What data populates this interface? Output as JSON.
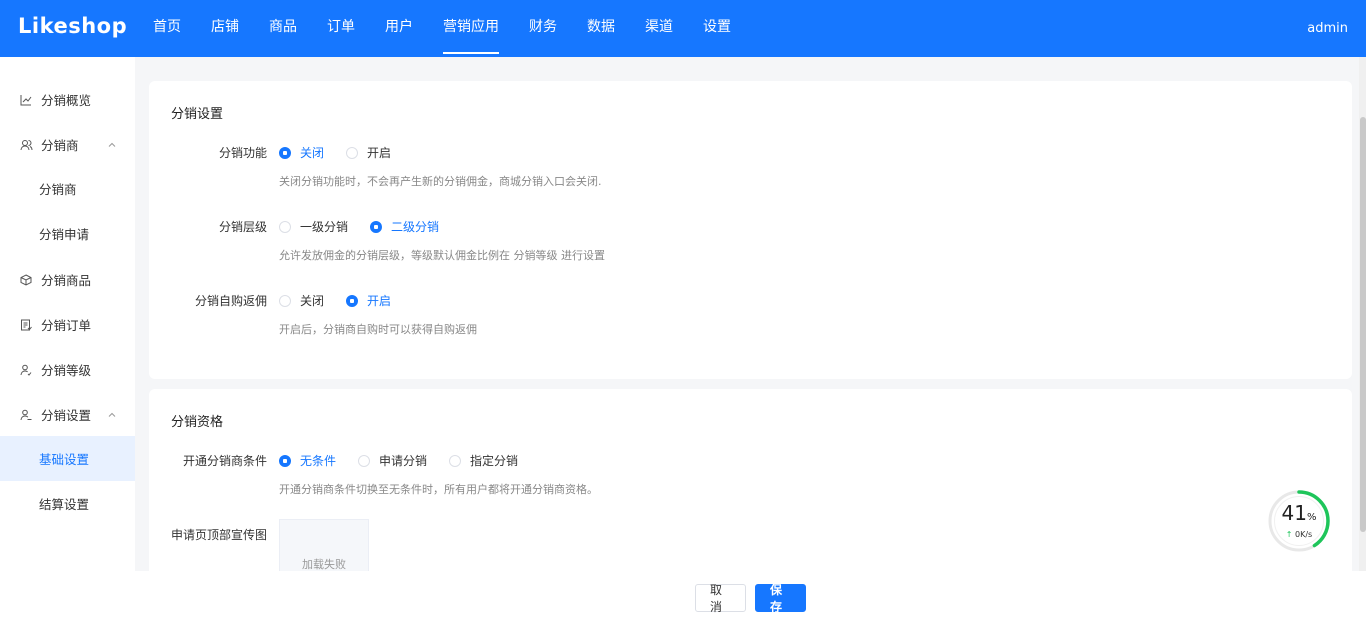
{
  "header": {
    "logo": "Likeshop",
    "nav": [
      "首页",
      "店铺",
      "商品",
      "订单",
      "用户",
      "营销应用",
      "财务",
      "数据",
      "渠道",
      "设置"
    ],
    "active_nav": 5,
    "user": "admin"
  },
  "sidebar": {
    "items": [
      {
        "label": "分销概览",
        "icon": "chart-line-icon"
      },
      {
        "label": "分销商",
        "icon": "users-icon",
        "expanded": true
      },
      {
        "label": "分销商"
      },
      {
        "label": "分销申请"
      },
      {
        "label": "分销商品",
        "icon": "box-icon"
      },
      {
        "label": "分销订单",
        "icon": "order-icon"
      },
      {
        "label": "分销等级",
        "icon": "user-level-icon"
      },
      {
        "label": "分销设置",
        "icon": "user-settings-icon",
        "expanded": true
      },
      {
        "label": "基础设置",
        "active": true
      },
      {
        "label": "结算设置"
      }
    ]
  },
  "section1": {
    "title": "分销设置",
    "rows": [
      {
        "label": "分销功能",
        "options": [
          "关闭",
          "开启"
        ],
        "selected": 0,
        "hint": "关闭分销功能时，不会再产生新的分销佣金，商城分销入口会关闭."
      },
      {
        "label": "分销层级",
        "options": [
          "一级分销",
          "二级分销"
        ],
        "selected": 1,
        "hint": "允许发放佣金的分销层级，等级默认佣金比例在 分销等级 进行设置"
      },
      {
        "label": "分销自购返佣",
        "options": [
          "关闭",
          "开启"
        ],
        "selected": 1,
        "hint": "开启后，分销商自购时可以获得自购返佣"
      }
    ]
  },
  "section2": {
    "title": "分销资格",
    "rows": [
      {
        "label": "开通分销商条件",
        "options": [
          "无条件",
          "申请分销",
          "指定分销"
        ],
        "selected": 0,
        "hint": "开通分销商条件切换至无条件时，所有用户都将开通分销商资格。"
      }
    ],
    "image_label": "申请页顶部宣传图",
    "image_fail": "加载失败"
  },
  "footer": {
    "cancel": "取消",
    "save": "保存"
  },
  "speed_widget": {
    "percent": "41",
    "percent_unit": "%",
    "rate": "0K/s",
    "progress": 0.41
  },
  "colors": {
    "primary": "#1677ff",
    "active_bg": "#e8f1ff",
    "speed_ring": "#1ec55a"
  }
}
